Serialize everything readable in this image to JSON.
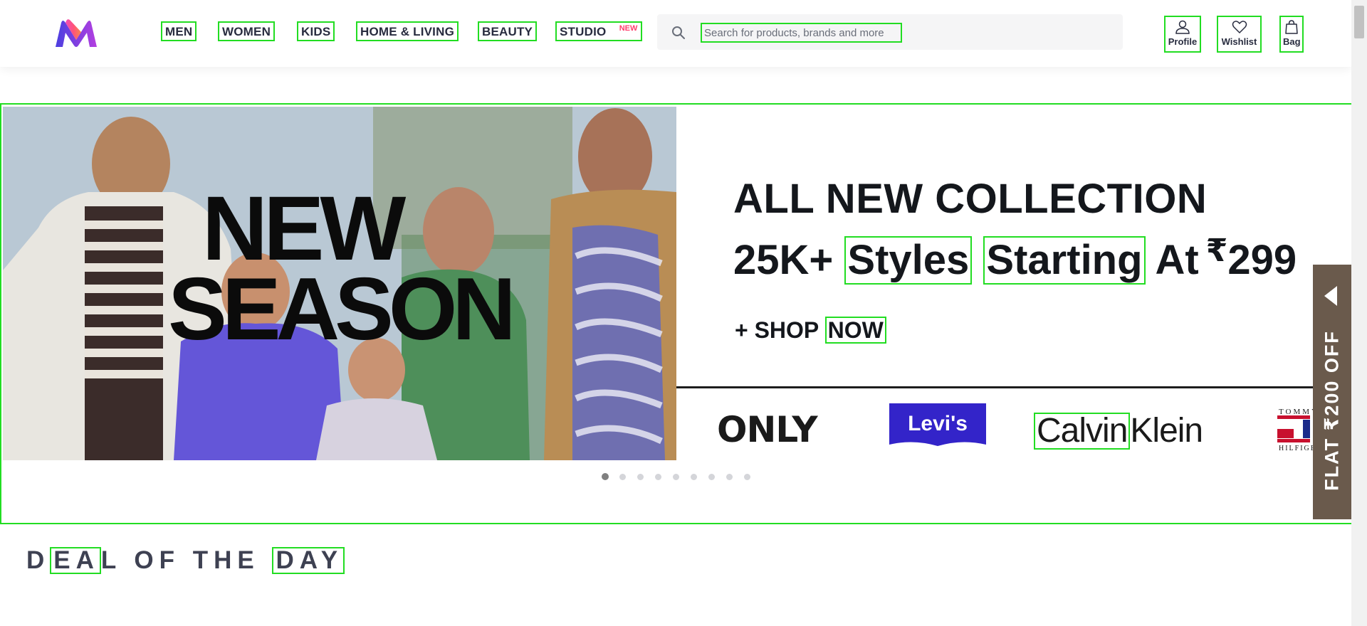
{
  "header": {
    "logo_name": "myntra-logo-icon",
    "nav": [
      {
        "label": "MEN"
      },
      {
        "label": "WOMEN"
      },
      {
        "label": "KIDS"
      },
      {
        "label": "HOME & LIVING"
      },
      {
        "label": "BEAUTY"
      },
      {
        "label": "STUDIO",
        "badge": "NEW"
      }
    ],
    "search": {
      "placeholder": "Search for products, brands and more",
      "value": ""
    },
    "actions": [
      {
        "label": "Profile",
        "icon": "profile-icon"
      },
      {
        "label": "Wishlist",
        "icon": "heart-icon"
      },
      {
        "label": "Bag",
        "icon": "bag-icon"
      }
    ]
  },
  "banner": {
    "image_text": [
      "NEW",
      "SEASON"
    ],
    "headline": "ALL NEW COLLECTION",
    "line2_prefix": "25K+",
    "line2_word1": "Styles",
    "line2_word2": "Starting",
    "line2_mid": "At",
    "currency": "₹",
    "price": "299",
    "cta_prefix": "+ SHOP",
    "cta_word": "NOW",
    "brands": {
      "only": "ONLY",
      "levis": "Levi's",
      "ck_word1": "Calvin",
      "ck_word2": "Klein",
      "tommy": [
        "TOMMY",
        "HILFIGER"
      ]
    },
    "carousel": {
      "total": 9,
      "active": 1
    }
  },
  "side_tab": {
    "label": "FLAT ₹200 OFF"
  },
  "deal": {
    "part1": "D",
    "part2": "EA",
    "part3": "L OF THE ",
    "part4": "DAY"
  },
  "colors": {
    "accent": "#ff3f6c",
    "side_tab": "#6a5a4c",
    "text": "#282c3f"
  }
}
